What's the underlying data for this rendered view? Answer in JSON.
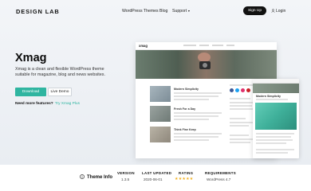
{
  "nav": {
    "logo": "DESIGN LAB",
    "items": [
      "WordPress Themes",
      "Blog",
      "Support"
    ],
    "signup": "Sign Up",
    "login": "Login"
  },
  "hero": {
    "title": "Xmag",
    "description": "Xmag is a clean and flexible WordPress theme suitable for magazine, blog and news websites.",
    "download": "Download",
    "live_demo": "Live Demo",
    "more_question": "Need more features?",
    "more_link": "Try Xmag Plus"
  },
  "preview": {
    "site_logo": "xmag",
    "post_titles": [
      "Modern Simplicity",
      "Fresh For a Day",
      "Think Fine Keep"
    ],
    "mobile_post_title": "Modern Simplicity"
  },
  "theme_info": {
    "title": "Theme Info",
    "version_label": "VERSION",
    "version": "1.3.5",
    "updated_label": "LAST UPDATED",
    "updated": "2020-06-01",
    "rating_label": "RATING",
    "rating": 5,
    "requirements_label": "REQUIREMENTS",
    "requirements": "WordPress 4.7"
  },
  "colors": {
    "accent": "#2fb5a0",
    "dark_button": "#111111",
    "stars": "#f2b01e"
  },
  "icons": {
    "login": "user-icon",
    "theme_info": "info-circle-icon",
    "support_caret": "caret-down-icon"
  }
}
